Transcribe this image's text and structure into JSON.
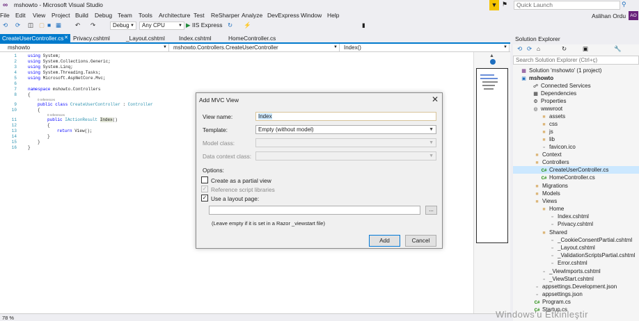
{
  "window": {
    "title": "mshowto - Microsoft Visual Studio"
  },
  "quick_launch": {
    "placeholder": "Quick Launch"
  },
  "menu": [
    "File",
    "Edit",
    "View",
    "Project",
    "Build",
    "Debug",
    "Team",
    "Tools",
    "Architecture",
    "Test",
    "ReSharper",
    "Analyze",
    "DevExpress",
    "Window",
    "Help"
  ],
  "user": {
    "name": "Aslihan Ordu",
    "initials": "AO"
  },
  "toolbar": {
    "config": "Debug",
    "platform": "Any CPU",
    "run": "IIS Express"
  },
  "tabs": [
    "CreateUserController.cs",
    "Privacy.cshtml",
    "_Layout.cshtml",
    "Index.cshtml",
    "HomeController.cs"
  ],
  "nav": {
    "project": "mshowto",
    "type": "mshowto.Controllers.CreateUserController",
    "member": "Index()"
  },
  "code": {
    "line_numbers": [
      "1",
      "2",
      "3",
      "4",
      "5",
      "6",
      "7",
      "8",
      "9",
      "10",
      "11",
      "12",
      "13",
      "14",
      "15",
      "16"
    ],
    "refs": [
      "0 references",
      "0 references"
    ]
  },
  "zoom": "78 %",
  "solution_explorer": {
    "title": "Solution Explorer",
    "search_placeholder": "Search Solution Explorer (Ctrl+ç)",
    "items": [
      {
        "label": "Solution 'mshowto' (1 project)",
        "icon": "solution-icon"
      },
      {
        "label": "mshowto",
        "icon": "web-project-icon"
      },
      {
        "label": "Connected Services",
        "icon": "connected-services-icon"
      },
      {
        "label": "Dependencies",
        "icon": "dependencies-icon"
      },
      {
        "label": "Properties",
        "icon": "wrench-icon"
      },
      {
        "label": "wwwroot",
        "icon": "globe-icon"
      },
      {
        "label": "assets",
        "icon": "folder-icon"
      },
      {
        "label": "css",
        "icon": "folder-icon"
      },
      {
        "label": "js",
        "icon": "folder-icon"
      },
      {
        "label": "lib",
        "icon": "folder-icon"
      },
      {
        "label": "favicon.ico",
        "icon": "file-icon"
      },
      {
        "label": "Context",
        "icon": "folder-icon"
      },
      {
        "label": "Controllers",
        "icon": "folder-icon"
      },
      {
        "label": "CreateUserController.cs",
        "icon": "csharp-icon"
      },
      {
        "label": "HomeController.cs",
        "icon": "csharp-icon"
      },
      {
        "label": "Migrations",
        "icon": "folder-icon"
      },
      {
        "label": "Models",
        "icon": "folder-icon"
      },
      {
        "label": "Views",
        "icon": "folder-icon"
      },
      {
        "label": "Home",
        "icon": "folder-icon"
      },
      {
        "label": "Index.cshtml",
        "icon": "page-icon"
      },
      {
        "label": "Privacy.cshtml",
        "icon": "page-icon"
      },
      {
        "label": "Shared",
        "icon": "folder-icon"
      },
      {
        "label": "_CookieConsentPartial.cshtml",
        "icon": "page-icon"
      },
      {
        "label": "_Layout.cshtml",
        "icon": "page-icon"
      },
      {
        "label": "_ValidationScriptsPartial.cshtml",
        "icon": "page-icon"
      },
      {
        "label": "Error.cshtml",
        "icon": "page-icon"
      },
      {
        "label": "_ViewImports.cshtml",
        "icon": "page-icon"
      },
      {
        "label": "_ViewStart.cshtml",
        "icon": "page-icon"
      },
      {
        "label": "appsettings.Development.json",
        "icon": "json-icon"
      },
      {
        "label": "appsettings.json",
        "icon": "json-icon"
      },
      {
        "label": "Program.cs",
        "icon": "csharp-icon"
      },
      {
        "label": "Startup.cs",
        "icon": "csharp-icon"
      }
    ]
  },
  "dialog": {
    "title": "Add MVC View",
    "view_name_label": "View name:",
    "view_name_value": "Index",
    "template_label": "Template:",
    "template_value": "Empty (without model)",
    "model_class_label": "Model class:",
    "data_context_label": "Data context class:",
    "options_label": "Options:",
    "partial_label": "Create as a partial view",
    "scripts_label": "Reference script libraries",
    "layout_label": "Use a layout page:",
    "browse_label": "...",
    "hint": "(Leave empty if it is set in a Razor _viewstart file)",
    "add_label": "Add",
    "cancel_label": "Cancel"
  },
  "watermark": "Windows'u Etkinleştir",
  "colors": {
    "accent": "#007acc",
    "user_badge": "#68217a",
    "selection": "#cce8ff"
  }
}
